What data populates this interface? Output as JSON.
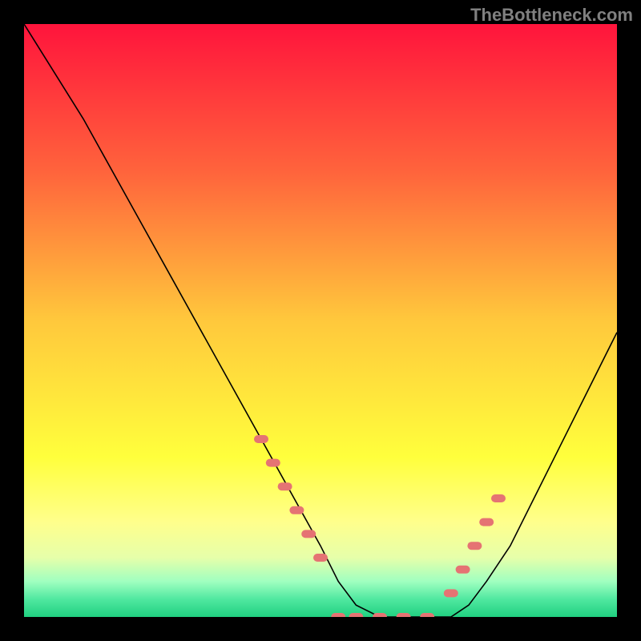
{
  "watermark": "TheBottleneck.com",
  "chart_data": {
    "type": "line",
    "title": "",
    "xlabel": "",
    "ylabel": "",
    "xlim": [
      0,
      100
    ],
    "ylim": [
      0,
      100
    ],
    "grid": false,
    "series": [
      {
        "name": "curve",
        "x": [
          0,
          5,
          10,
          15,
          20,
          25,
          30,
          35,
          40,
          45,
          50,
          53,
          56,
          60,
          64,
          68,
          72,
          75,
          78,
          82,
          86,
          90,
          94,
          98,
          100
        ],
        "y": [
          100,
          92,
          84,
          75,
          66,
          57,
          48,
          39,
          30,
          21,
          12,
          6,
          2,
          0,
          0,
          0,
          0,
          2,
          6,
          12,
          20,
          28,
          36,
          44,
          48
        ]
      }
    ],
    "markers": [
      {
        "name": "band-left",
        "x": [
          40,
          42,
          44,
          46,
          48,
          50
        ],
        "y": [
          30,
          26,
          22,
          18,
          14,
          10
        ],
        "color": "#e57373"
      },
      {
        "name": "band-bottom",
        "x": [
          53,
          56,
          60,
          64,
          68
        ],
        "y": [
          0,
          0,
          0,
          0,
          0
        ],
        "color": "#e57373"
      },
      {
        "name": "band-right",
        "x": [
          72,
          74,
          76,
          78,
          80
        ],
        "y": [
          4,
          8,
          12,
          16,
          20
        ],
        "color": "#e57373"
      }
    ],
    "background_gradient": {
      "stops": [
        {
          "offset": 0.0,
          "color": "#ff143c"
        },
        {
          "offset": 0.25,
          "color": "#ff643c"
        },
        {
          "offset": 0.5,
          "color": "#ffc83c"
        },
        {
          "offset": 0.73,
          "color": "#ffff3c"
        },
        {
          "offset": 0.84,
          "color": "#ffff8c"
        },
        {
          "offset": 0.9,
          "color": "#e6ffaa"
        },
        {
          "offset": 0.94,
          "color": "#a0ffc0"
        },
        {
          "offset": 0.97,
          "color": "#50e8a0"
        },
        {
          "offset": 1.0,
          "color": "#20d080"
        }
      ]
    }
  }
}
